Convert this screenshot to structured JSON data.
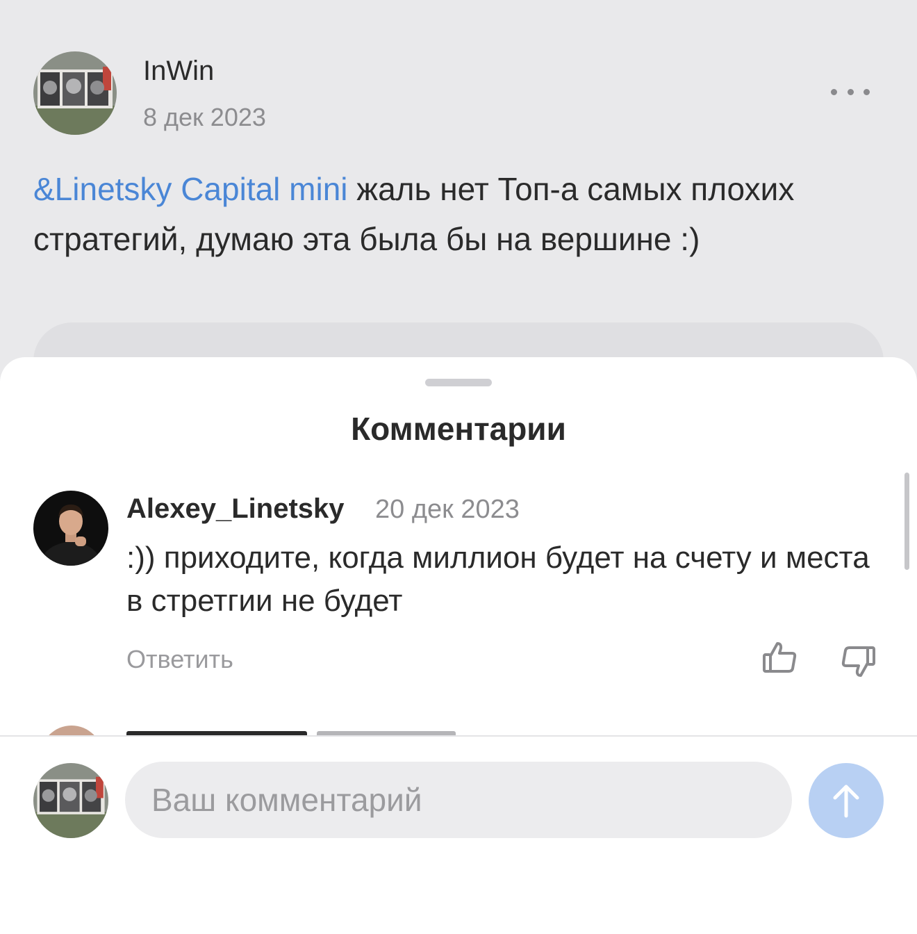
{
  "post": {
    "author": "InWin",
    "date": "8 дек 2023",
    "mention": "&Linetsky Capital mini",
    "text": " жаль нет Топ-а самых плохих стратегий, думаю эта была бы на вершине :)",
    "menu_icon": "more-horizontal-icon"
  },
  "sheet": {
    "title": "Комментарии"
  },
  "comment": {
    "author": "Alexey_Linetsky",
    "date": "20 дек 2023",
    "text": ":)) приходите, когда миллион будет на счету и места в стретгии не будет",
    "reply_label": "Ответить",
    "like_icon": "thumbs-up-icon",
    "dislike_icon": "thumbs-down-icon"
  },
  "composer": {
    "placeholder": "Ваш комментарий",
    "send_icon": "arrow-up-icon",
    "send_color": "#b8d0f3"
  },
  "colors": {
    "accent": "#4a86d6",
    "muted": "#8c8c8f"
  }
}
